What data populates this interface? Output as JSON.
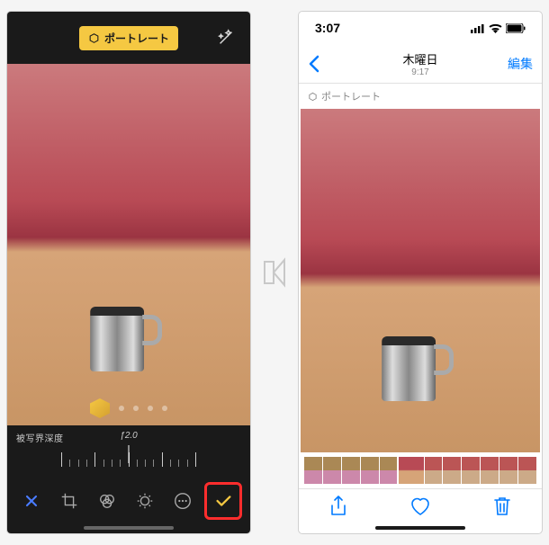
{
  "edit": {
    "portrait_badge": "ポートレート",
    "depth_label": "被写界深度",
    "fstop": "ƒ2.0",
    "icons": {
      "wand": "wand-icon",
      "cancel": "×",
      "crop": "crop-icon",
      "filters": "filters-icon",
      "adjust": "adjust-icon",
      "more": "more-icon",
      "done": "✓"
    }
  },
  "view": {
    "status_time": "3:07",
    "title_day": "木曜日",
    "title_time": "9:17",
    "edit_link": "編集",
    "portrait_tag": "ポートレート"
  },
  "colors": {
    "accent_yellow": "#f5c842",
    "ios_blue": "#007aff",
    "highlight_red": "#ff2d2d"
  }
}
